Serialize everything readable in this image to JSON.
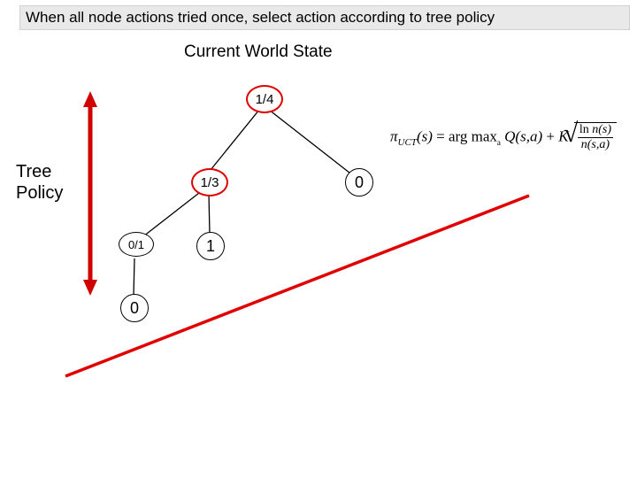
{
  "title": "When all node actions tried once, select action according to tree policy",
  "subtitle": "Current World State",
  "policy_label_line1": "Tree",
  "policy_label_line2": "Policy",
  "nodes": {
    "root": {
      "label": "1/4"
    },
    "left": {
      "label": "1/3"
    },
    "right": {
      "label": "0"
    },
    "ll": {
      "label": "0/1"
    },
    "lr": {
      "label": "1"
    },
    "lll": {
      "label": "0"
    }
  },
  "equation": {
    "lhs_pi": "π",
    "lhs_sub": "UCT",
    "lhs_arg": "(s)",
    "eq": " = ",
    "argmax": "arg max",
    "argmax_sub": "a",
    "Q": "Q(s,a)",
    "plus": " + ",
    "K": "K",
    "num_ln": "ln ",
    "num_n": "n(s)",
    "den_n": "n(s,a)"
  }
}
